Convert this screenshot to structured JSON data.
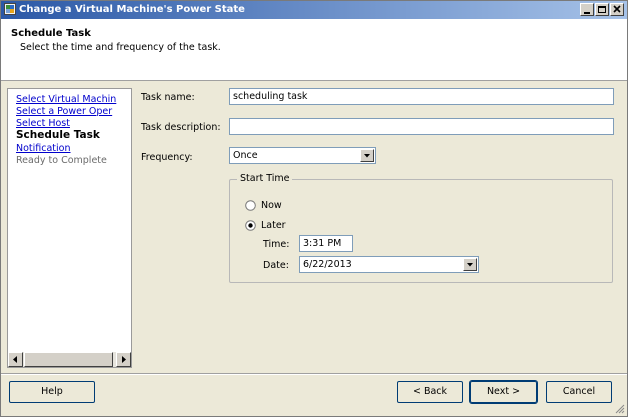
{
  "window": {
    "title": "Change a Virtual Machine's Power State"
  },
  "header": {
    "title": "Schedule Task",
    "subtitle": "Select the time and frequency of the task."
  },
  "nav": {
    "items": [
      {
        "label": "Select Virtual Machin",
        "state": "link"
      },
      {
        "label": "Select a Power Oper",
        "state": "link"
      },
      {
        "label": "Select Host",
        "state": "link"
      },
      {
        "label": "Schedule Task",
        "state": "current"
      },
      {
        "label": "Notification",
        "state": "link"
      },
      {
        "label": "Ready to Complete",
        "state": "disabled"
      }
    ]
  },
  "form": {
    "task_name_label": "Task name:",
    "task_name_value": "scheduling task",
    "task_desc_label": "Task description:",
    "task_desc_value": "",
    "frequency_label": "Frequency:",
    "frequency_value": "Once",
    "start_time": {
      "legend": "Start Time",
      "now_label": "Now",
      "later_label": "Later",
      "selected": "Later",
      "time_label": "Time:",
      "time_value": "3:31 PM",
      "date_label": "Date:",
      "date_value": "6/22/2013"
    }
  },
  "buttons": {
    "help": "Help",
    "back": "< Back",
    "next": "Next >",
    "cancel": "Cancel"
  },
  "icons": {
    "app": "vm-power-icon",
    "minimize": "minimize-icon",
    "maximize": "maximize-icon",
    "close": "close-icon"
  }
}
